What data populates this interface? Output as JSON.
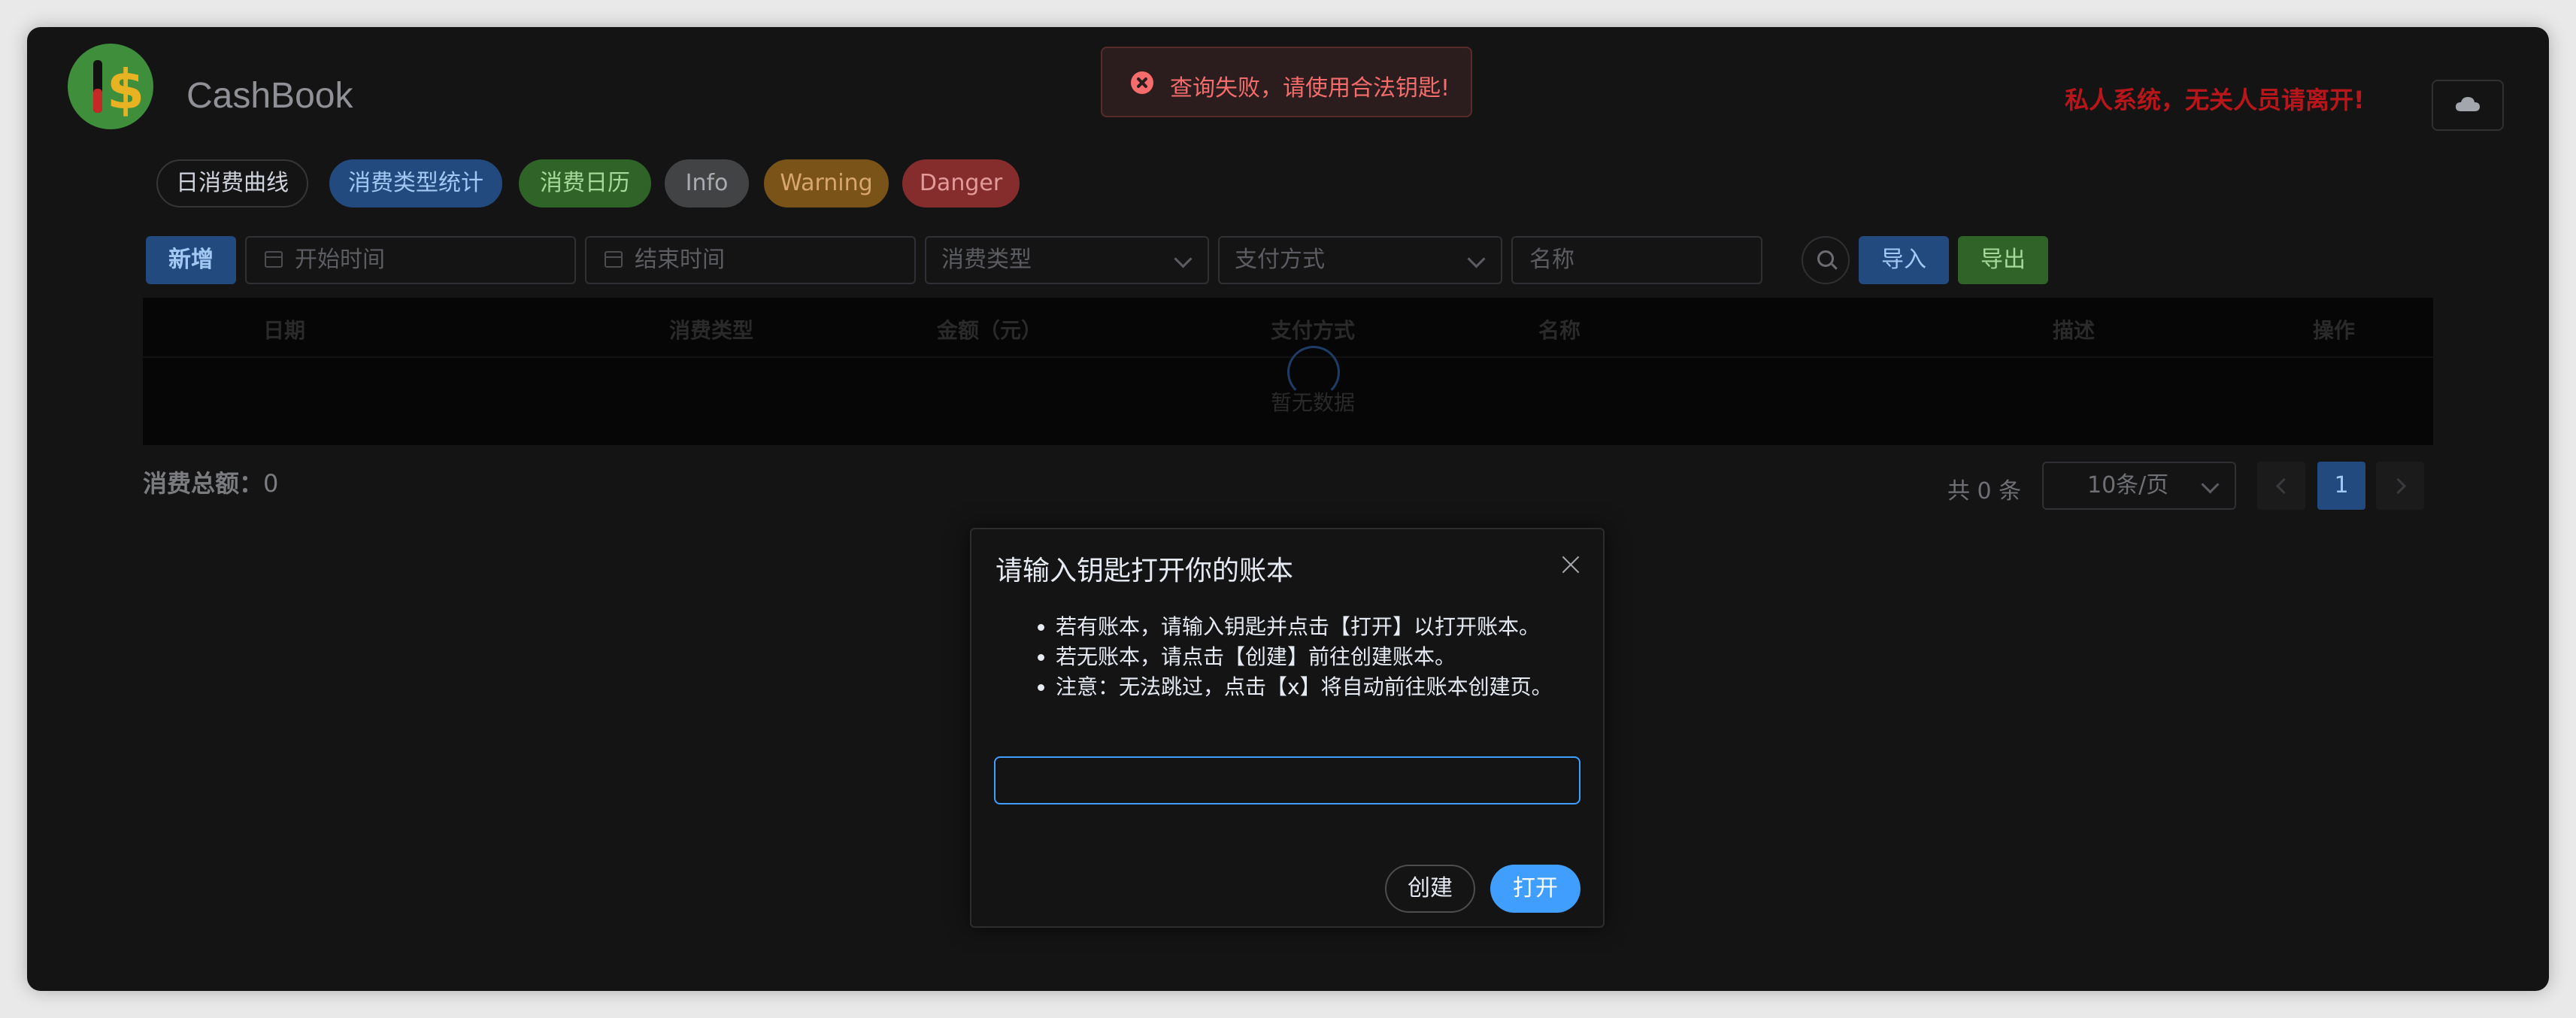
{
  "app": {
    "title": "CashBook",
    "logo_icon": "dollar-icon",
    "warning": "私人系统，无关人员请离开!",
    "cloud_icon": "cloud-icon"
  },
  "toast": {
    "type": "error",
    "message": "查询失败，请使用合法钥匙!"
  },
  "tabs": [
    {
      "label": "日消费曲线"
    },
    {
      "label": "消费类型统计"
    },
    {
      "label": "消费日历"
    },
    {
      "label": "Info"
    },
    {
      "label": "Warning"
    },
    {
      "label": "Danger"
    }
  ],
  "toolbar": {
    "add_label": "新增",
    "start_date_placeholder": "开始时间",
    "end_date_placeholder": "结束时间",
    "type_placeholder": "消费类型",
    "payment_placeholder": "支付方式",
    "name_placeholder": "名称",
    "import_label": "导入",
    "export_label": "导出"
  },
  "table": {
    "columns": [
      "日期",
      "消费类型",
      "金额（元）",
      "支付方式",
      "名称",
      "描述",
      "操作"
    ],
    "empty_text": "暂无数据"
  },
  "summary": {
    "label": "消费总额：",
    "value": "0"
  },
  "pagination": {
    "total_text": "共 0 条",
    "page_size": "10条/页",
    "current_page": "1"
  },
  "dialog": {
    "title": "请输入钥匙打开你的账本",
    "instructions": [
      "若有账本，请输入钥匙并点击【打开】以打开账本。",
      "若无账本，请点击【创建】前往创建账本。",
      "注意：无法跳过，点击【x】将自动前往账本创建页。"
    ],
    "input_value": "",
    "create_label": "创建",
    "open_label": "打开"
  },
  "colors": {
    "primary": "#409eff",
    "success": "#3f8e3c",
    "danger": "#f56c6c",
    "warning_text": "#b8161b"
  }
}
